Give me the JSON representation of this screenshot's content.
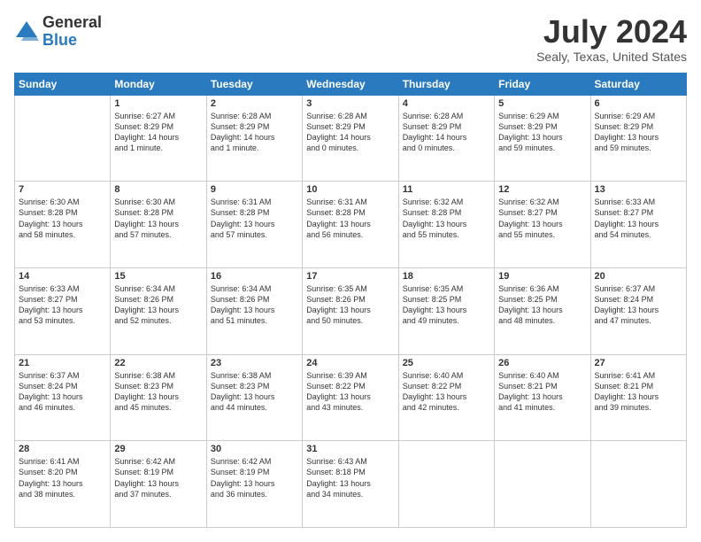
{
  "header": {
    "logo_general": "General",
    "logo_blue": "Blue",
    "month_year": "July 2024",
    "location": "Sealy, Texas, United States"
  },
  "calendar": {
    "columns": [
      "Sunday",
      "Monday",
      "Tuesday",
      "Wednesday",
      "Thursday",
      "Friday",
      "Saturday"
    ],
    "weeks": [
      [
        {
          "num": "",
          "info": ""
        },
        {
          "num": "1",
          "info": "Sunrise: 6:27 AM\nSunset: 8:29 PM\nDaylight: 14 hours\nand 1 minute."
        },
        {
          "num": "2",
          "info": "Sunrise: 6:28 AM\nSunset: 8:29 PM\nDaylight: 14 hours\nand 1 minute."
        },
        {
          "num": "3",
          "info": "Sunrise: 6:28 AM\nSunset: 8:29 PM\nDaylight: 14 hours\nand 0 minutes."
        },
        {
          "num": "4",
          "info": "Sunrise: 6:28 AM\nSunset: 8:29 PM\nDaylight: 14 hours\nand 0 minutes."
        },
        {
          "num": "5",
          "info": "Sunrise: 6:29 AM\nSunset: 8:29 PM\nDaylight: 13 hours\nand 59 minutes."
        },
        {
          "num": "6",
          "info": "Sunrise: 6:29 AM\nSunset: 8:29 PM\nDaylight: 13 hours\nand 59 minutes."
        }
      ],
      [
        {
          "num": "7",
          "info": "Sunrise: 6:30 AM\nSunset: 8:28 PM\nDaylight: 13 hours\nand 58 minutes."
        },
        {
          "num": "8",
          "info": "Sunrise: 6:30 AM\nSunset: 8:28 PM\nDaylight: 13 hours\nand 57 minutes."
        },
        {
          "num": "9",
          "info": "Sunrise: 6:31 AM\nSunset: 8:28 PM\nDaylight: 13 hours\nand 57 minutes."
        },
        {
          "num": "10",
          "info": "Sunrise: 6:31 AM\nSunset: 8:28 PM\nDaylight: 13 hours\nand 56 minutes."
        },
        {
          "num": "11",
          "info": "Sunrise: 6:32 AM\nSunset: 8:28 PM\nDaylight: 13 hours\nand 55 minutes."
        },
        {
          "num": "12",
          "info": "Sunrise: 6:32 AM\nSunset: 8:27 PM\nDaylight: 13 hours\nand 55 minutes."
        },
        {
          "num": "13",
          "info": "Sunrise: 6:33 AM\nSunset: 8:27 PM\nDaylight: 13 hours\nand 54 minutes."
        }
      ],
      [
        {
          "num": "14",
          "info": "Sunrise: 6:33 AM\nSunset: 8:27 PM\nDaylight: 13 hours\nand 53 minutes."
        },
        {
          "num": "15",
          "info": "Sunrise: 6:34 AM\nSunset: 8:26 PM\nDaylight: 13 hours\nand 52 minutes."
        },
        {
          "num": "16",
          "info": "Sunrise: 6:34 AM\nSunset: 8:26 PM\nDaylight: 13 hours\nand 51 minutes."
        },
        {
          "num": "17",
          "info": "Sunrise: 6:35 AM\nSunset: 8:26 PM\nDaylight: 13 hours\nand 50 minutes."
        },
        {
          "num": "18",
          "info": "Sunrise: 6:35 AM\nSunset: 8:25 PM\nDaylight: 13 hours\nand 49 minutes."
        },
        {
          "num": "19",
          "info": "Sunrise: 6:36 AM\nSunset: 8:25 PM\nDaylight: 13 hours\nand 48 minutes."
        },
        {
          "num": "20",
          "info": "Sunrise: 6:37 AM\nSunset: 8:24 PM\nDaylight: 13 hours\nand 47 minutes."
        }
      ],
      [
        {
          "num": "21",
          "info": "Sunrise: 6:37 AM\nSunset: 8:24 PM\nDaylight: 13 hours\nand 46 minutes."
        },
        {
          "num": "22",
          "info": "Sunrise: 6:38 AM\nSunset: 8:23 PM\nDaylight: 13 hours\nand 45 minutes."
        },
        {
          "num": "23",
          "info": "Sunrise: 6:38 AM\nSunset: 8:23 PM\nDaylight: 13 hours\nand 44 minutes."
        },
        {
          "num": "24",
          "info": "Sunrise: 6:39 AM\nSunset: 8:22 PM\nDaylight: 13 hours\nand 43 minutes."
        },
        {
          "num": "25",
          "info": "Sunrise: 6:40 AM\nSunset: 8:22 PM\nDaylight: 13 hours\nand 42 minutes."
        },
        {
          "num": "26",
          "info": "Sunrise: 6:40 AM\nSunset: 8:21 PM\nDaylight: 13 hours\nand 41 minutes."
        },
        {
          "num": "27",
          "info": "Sunrise: 6:41 AM\nSunset: 8:21 PM\nDaylight: 13 hours\nand 39 minutes."
        }
      ],
      [
        {
          "num": "28",
          "info": "Sunrise: 6:41 AM\nSunset: 8:20 PM\nDaylight: 13 hours\nand 38 minutes."
        },
        {
          "num": "29",
          "info": "Sunrise: 6:42 AM\nSunset: 8:19 PM\nDaylight: 13 hours\nand 37 minutes."
        },
        {
          "num": "30",
          "info": "Sunrise: 6:42 AM\nSunset: 8:19 PM\nDaylight: 13 hours\nand 36 minutes."
        },
        {
          "num": "31",
          "info": "Sunrise: 6:43 AM\nSunset: 8:18 PM\nDaylight: 13 hours\nand 34 minutes."
        },
        {
          "num": "",
          "info": ""
        },
        {
          "num": "",
          "info": ""
        },
        {
          "num": "",
          "info": ""
        }
      ]
    ]
  }
}
